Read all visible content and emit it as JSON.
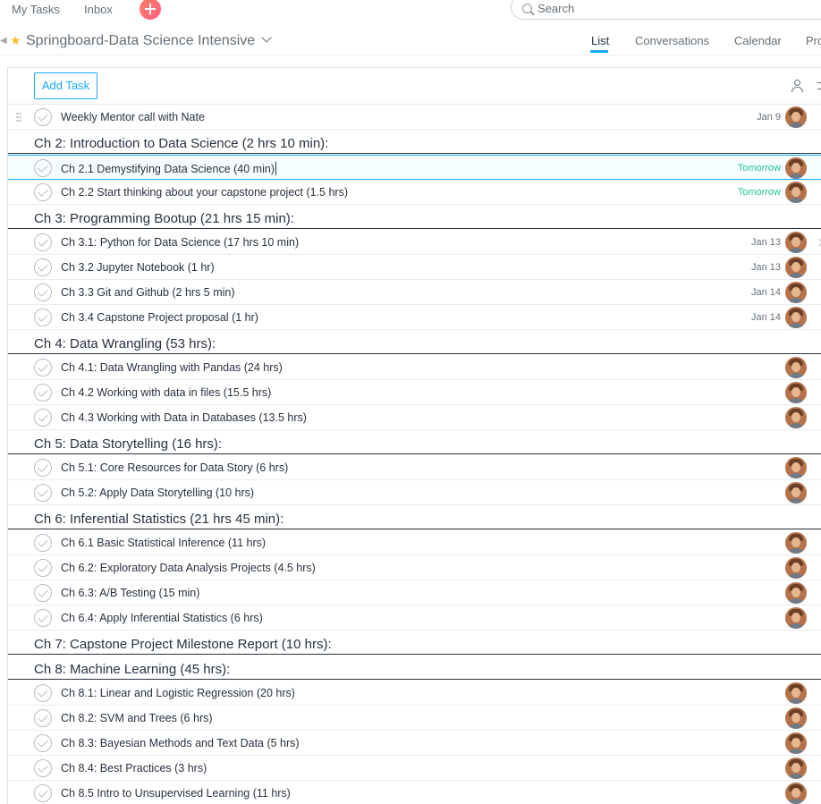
{
  "topbar": {
    "my_tasks": "My Tasks",
    "inbox": "Inbox",
    "search_placeholder": "Search"
  },
  "header": {
    "project_title": "Springboard-Data Science Intensive",
    "tabs": [
      "List",
      "Conversations",
      "Calendar",
      "Pro"
    ],
    "active_tab": "List"
  },
  "toolbar": {
    "add_task_label": "Add Task"
  },
  "colors": {
    "accent": "#14aaf5",
    "due_tomorrow": "#25c298",
    "star": "#f8c12c",
    "add_button": "#fc636b"
  },
  "rows": [
    {
      "type": "task",
      "name": "Weekly Mentor call with Nate",
      "due": "Jan 9",
      "assignee": true,
      "drag": true
    },
    {
      "type": "section",
      "name": "Ch 2: Introduction to Data Science (2 hrs 10 min):"
    },
    {
      "type": "task",
      "name": "Ch 2.1 Demystifying Data Science (40 min)",
      "due": "Tomorrow",
      "due_status": "tomorrow",
      "assignee": true,
      "selected": true
    },
    {
      "type": "task",
      "name": "Ch 2.2 Start thinking about your capstone project (1.5 hrs)",
      "due": "Tomorrow",
      "due_status": "tomorrow",
      "assignee": true
    },
    {
      "type": "section",
      "name": "Ch 3: Programming Bootup (21 hrs 15 min):"
    },
    {
      "type": "task",
      "name": "Ch 3.1: Python for Data Science (17 hrs 10 min)",
      "due": "Jan 13",
      "assignee": true,
      "chevron": true
    },
    {
      "type": "task",
      "name": "Ch 3.2 Jupyter Notebook (1 hr)",
      "due": "Jan 13",
      "assignee": true
    },
    {
      "type": "task",
      "name": "Ch 3.3 Git and Github (2 hrs 5 min)",
      "due": "Jan 14",
      "assignee": true
    },
    {
      "type": "task",
      "name": "Ch 3.4 Capstone Project proposal (1 hr)",
      "due": "Jan 14",
      "assignee": true
    },
    {
      "type": "section",
      "name": "Ch 4: Data Wrangling (53 hrs):"
    },
    {
      "type": "task",
      "name": "Ch 4.1: Data Wrangling with Pandas (24 hrs)",
      "due": "",
      "assignee": true
    },
    {
      "type": "task",
      "name": "Ch 4.2 Working with data in files (15.5 hrs)",
      "due": "",
      "assignee": true
    },
    {
      "type": "task",
      "name": "Ch 4.3 Working with Data in Databases (13.5 hrs)",
      "due": "",
      "assignee": true
    },
    {
      "type": "section",
      "name": "Ch 5: Data Storytelling (16 hrs):"
    },
    {
      "type": "task",
      "name": "Ch 5.1: Core Resources for Data Story (6 hrs)",
      "due": "",
      "assignee": true
    },
    {
      "type": "task",
      "name": "Ch 5.2: Apply Data Storytelling (10 hrs)",
      "due": "",
      "assignee": true
    },
    {
      "type": "section",
      "name": "Ch 6: Inferential Statistics (21 hrs 45 min):"
    },
    {
      "type": "task",
      "name": "Ch 6.1 Basic Statistical Inference (11 hrs)",
      "due": "",
      "assignee": true
    },
    {
      "type": "task",
      "name": "Ch 6.2: Exploratory Data Analysis Projects (4.5 hrs)",
      "due": "",
      "assignee": true
    },
    {
      "type": "task",
      "name": "Ch 6.3: A/B Testing (15 min)",
      "due": "",
      "assignee": true
    },
    {
      "type": "task",
      "name": "Ch 6.4: Apply Inferential Statistics (6 hrs)",
      "due": "",
      "assignee": true
    },
    {
      "type": "section",
      "name": "Ch 7: Capstone Project Milestone Report (10 hrs):"
    },
    {
      "type": "section",
      "name": "Ch 8: Machine Learning (45 hrs):"
    },
    {
      "type": "task",
      "name": "Ch 8.1: Linear and Logistic Regression (20 hrs)",
      "due": "",
      "assignee": true
    },
    {
      "type": "task",
      "name": "Ch 8.2: SVM and Trees (6 hrs)",
      "due": "",
      "assignee": true
    },
    {
      "type": "task",
      "name": "Ch 8.3: Bayesian Methods and Text Data (5 hrs)",
      "due": "",
      "assignee": true
    },
    {
      "type": "task",
      "name": "Ch 8.4: Best Practices (3 hrs)",
      "due": "",
      "assignee": true
    },
    {
      "type": "task",
      "name": "Ch 8.5 Intro to Unsupervised Learning (11 hrs)",
      "due": "",
      "assignee": true
    }
  ]
}
